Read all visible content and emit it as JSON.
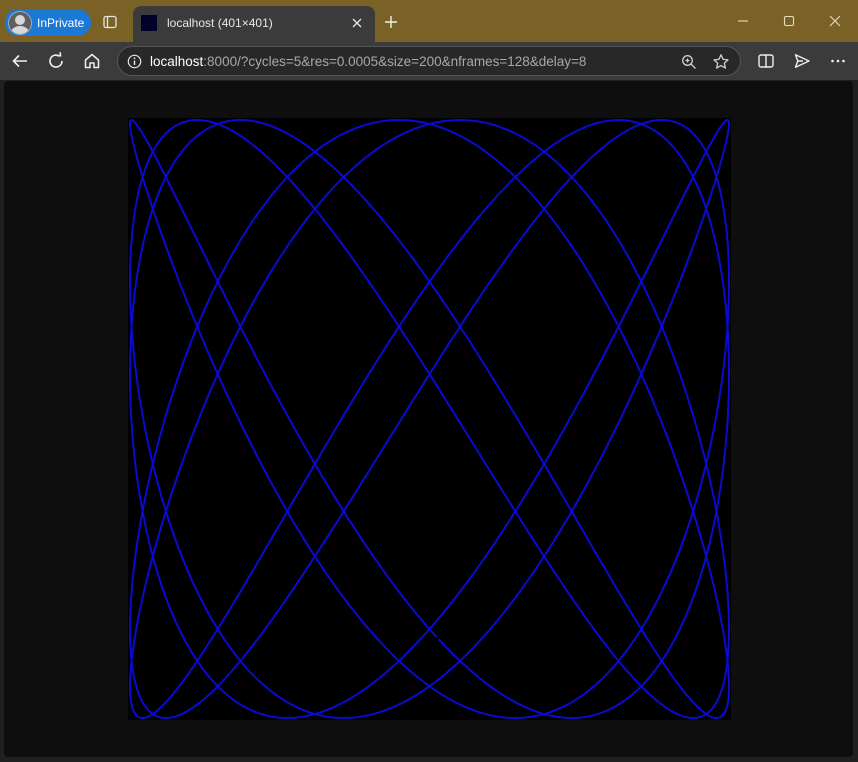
{
  "browser": {
    "inprivate_label": "InPrivate",
    "tab": {
      "title": "localhost (401×401)",
      "favicon_color": "#01012a"
    },
    "address": {
      "host": "localhost",
      "rest": ":8000/?cycles=5&res=0.0005&size=200&nframes=128&delay=8"
    },
    "icons": {
      "tab_actions": "tab-actions-icon",
      "new_tab": "plus-icon",
      "minimize": "minimize-icon",
      "maximize": "maximize-icon",
      "close": "close-icon",
      "back": "back-arrow-icon",
      "refresh": "refresh-icon",
      "home": "home-icon",
      "site_info": "info-icon",
      "zoom": "zoom-icon",
      "favorite": "star-icon",
      "split_screen": "split-screen-icon",
      "share": "send-icon",
      "more": "ellipsis-icon"
    },
    "colors": {
      "titlebar": "#7a6227",
      "inprivate_badge": "#1b78d4",
      "tab": "#3b3b3b"
    }
  },
  "image": {
    "background": "#000000",
    "curve_color": "#0a0ad2",
    "curve": {
      "type": "lissajous",
      "cycles": 5,
      "x_frequency": 1,
      "y_frequency": 1.6,
      "phase": 2.35,
      "t_start": 0.03,
      "t_end": 31.45,
      "resolution": 0.0005
    }
  }
}
